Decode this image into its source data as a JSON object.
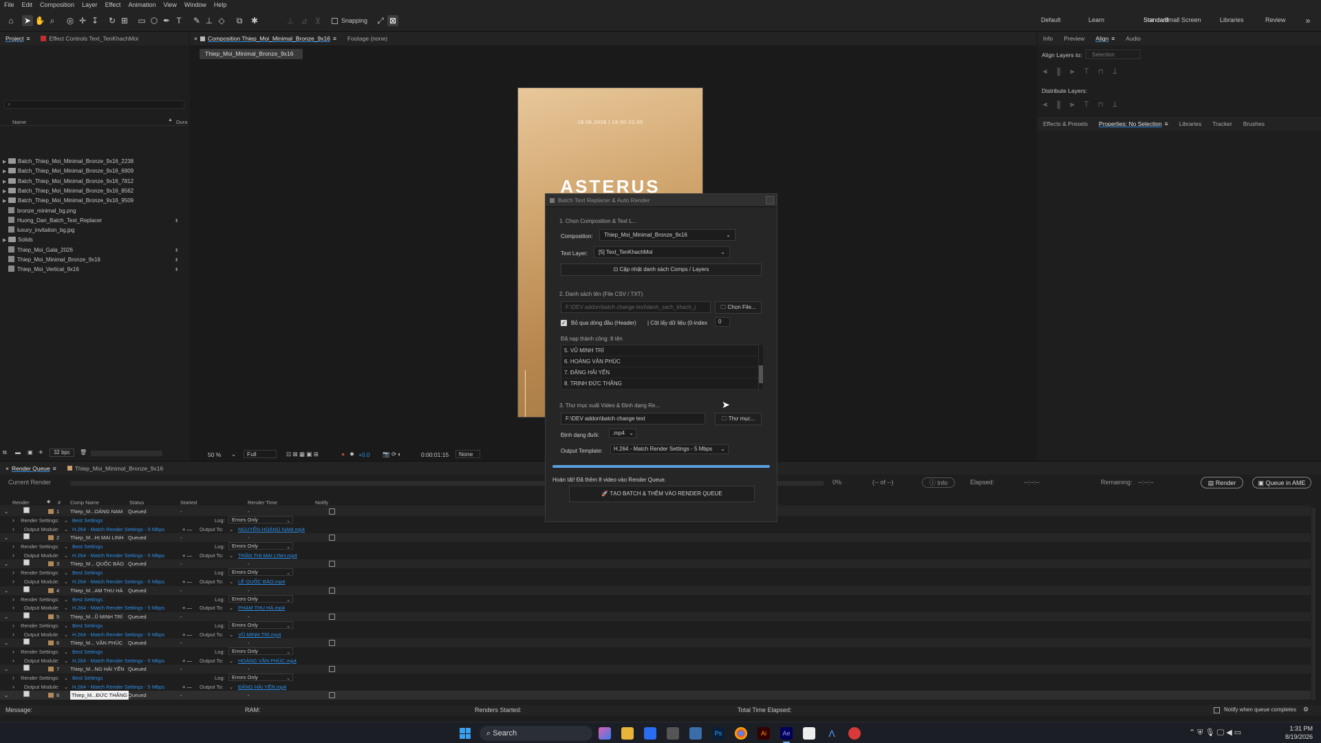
{
  "menu": [
    "File",
    "Edit",
    "Composition",
    "Layer",
    "Effect",
    "Animation",
    "View",
    "Window",
    "Help"
  ],
  "toolbar": {
    "snapping": "Snapping"
  },
  "workspaces": [
    "Default",
    "Learn",
    "Standard",
    "Small Screen",
    "Libraries",
    "Review"
  ],
  "project": {
    "tab": "Project",
    "effect_tab": "Effect Controls Text_TenKhachMoi",
    "col_name": "Name",
    "col_dur": "Dura",
    "items": [
      {
        "name": "Batch_Thiep_Moi_Minimal_Bronze_9x16_2238",
        "type": "folder"
      },
      {
        "name": "Batch_Thiep_Moi_Minimal_Bronze_9x16_6909",
        "type": "folder"
      },
      {
        "name": "Batch_Thiep_Moi_Minimal_Bronze_9x16_7812",
        "type": "folder"
      },
      {
        "name": "Batch_Thiep_Moi_Minimal_Bronze_9x16_8562",
        "type": "folder"
      },
      {
        "name": "Batch_Thiep_Moi_Minimal_Bronze_9x16_9509",
        "type": "folder"
      },
      {
        "name": "bronze_minimal_bg.png",
        "type": "file"
      },
      {
        "name": "Huong_Dan_Batch_Text_Replacer",
        "type": "file"
      },
      {
        "name": "luxury_invitation_bg.jpg",
        "type": "file"
      },
      {
        "name": "Solids",
        "type": "folder"
      },
      {
        "name": "Thiep_Moi_Gala_2026",
        "type": "comp"
      },
      {
        "name": "Thiep_Moi_Minimal_Bronze_9x16",
        "type": "comp"
      },
      {
        "name": "Thiep_Moi_Vertical_9x16",
        "type": "comp"
      }
    ],
    "bpc": "32 bpc"
  },
  "comp": {
    "tab": "Composition Thiep_Moi_Minimal_Bronze_9x16",
    "footage": "Footage (none)",
    "chip": "Thiep_Moi_Minimal_Bronze_9x16",
    "date": "18.06.2026   |   18:00-22:00",
    "title": "ASTERUS",
    "zoom": "50 %",
    "res": "Full",
    "exposure": "+0.0",
    "time": "0:00:01:15",
    "view": "None"
  },
  "right": {
    "tabs": [
      "Info",
      "Preview",
      "Align",
      "Audio"
    ],
    "align_to_label": "Align Layers to:",
    "align_to_value": "Selection",
    "distribute": "Distribute Layers:",
    "tabs2": [
      "Effects & Presets",
      "Properties: No Selection",
      "Libraries",
      "Tracker",
      "Brushes"
    ]
  },
  "dialog": {
    "title": "Batch Text Replacer & Auto Render",
    "s1": "1. Chọn Composition & Text L...",
    "comp_label": "Composition:",
    "comp_value": "Thiep_Moi_Minimal_Bronze_9x16",
    "layer_label": "Text Layer:",
    "layer_value": "[5] Text_TenKhachMoi",
    "refresh": "Cập nhật danh sách Comps / Layers",
    "s2": "2. Danh sách tên (File CSV / TXT)",
    "file_path": "F:\\DEV addon\\batch change text\\danh_sach_khach_j",
    "choose_file": "Chọn File...",
    "skip_header": "Bỏ qua dòng đầu (Header)",
    "col_label": "| Cột lấy dữ liệu (0-index",
    "col_value": "0",
    "loaded": "Đã nạp thành công: 8 tên",
    "names": [
      "5. VŨ MINH TRÍ",
      "6. HOÀNG VĂN PHÚC",
      "7. ĐẶNG HẢI YẾN",
      "8. TRỊNH ĐỨC THẮNG"
    ],
    "s3": "3. Thư mục xuất Video & Định dạng Re...",
    "out_path": "F:\\DEV addon\\batch change text",
    "folder_btn": "Thư mục...",
    "format_label": "Định dạng đuôi:",
    "format_value": ".mp4",
    "template_label": "Output Template:",
    "template_value": "H.264 - Match Render Settings - 5 Mbps",
    "progress": 1.0,
    "done": "Hoàn tất! Đã thêm 8 video vào Render Queue.",
    "run_btn": "TẠO BATCH & THÊM VÀO RENDER QUEUE"
  },
  "rq": {
    "tab": "Render Queue",
    "comp_tab": "Thiep_Moi_Minimal_Bronze_9x16",
    "current": "Current Render",
    "pct": "0%",
    "of": "(-- of --)",
    "info": "Info",
    "elapsed": "Elapsed:",
    "elapsed_v": "--:--:--",
    "remaining": "Remaining:",
    "remaining_v": "--:--:--",
    "render": "Render",
    "ame": "Queue in AME",
    "cols": [
      "Render",
      "#",
      "Comp Name",
      "Status",
      "Started",
      "Render Time",
      "Notify"
    ],
    "rs_label": "Render Settings:",
    "rs_value": "Best Settings",
    "om_label": "Output Module:",
    "om_value": "H.264 - Match Render Settings - 5 Mbps",
    "log_label": "Log:",
    "log_value": "Errors Only",
    "out_label": "Output To:",
    "items": [
      {
        "n": "1",
        "name": "Thiep_M...OÀNG NAM",
        "status": "Queued",
        "out": "NGUYỄN HOÀNG NAM.mp4"
      },
      {
        "n": "2",
        "name": "Thiep_M...HỊ MAI LINH",
        "status": "Queued",
        "out": "TRẦN THỊ MAI LINH.mp4"
      },
      {
        "n": "3",
        "name": "Thiep_M... QUỐC BẢO",
        "status": "Queued",
        "out": "LÊ QUỐC BẢO.mp4"
      },
      {
        "n": "4",
        "name": "Thiep_M...AM THU HÀ",
        "status": "Queued",
        "out": "PHẠM THU HÀ.mp4"
      },
      {
        "n": "5",
        "name": "Thiep_M...Ũ MINH TRÍ",
        "status": "Queued",
        "out": "VŨ MINH TRÍ.mp4"
      },
      {
        "n": "6",
        "name": "Thiep_M... VĂN PHÚC",
        "status": "Queued",
        "out": "HOÀNG VĂN PHÚC.mp4"
      },
      {
        "n": "7",
        "name": "Thiep_M...NG HẢI YẾN",
        "status": "Queued",
        "out": "ĐẶNG HẢI YẾN.mp4"
      },
      {
        "n": "8",
        "name": "Thiep_M...ĐỨC THẮNG",
        "status": "Queued",
        "out": ""
      }
    ]
  },
  "status": {
    "message": "Message:",
    "ram": "RAM:",
    "started": "Renders Started:",
    "total": "Total Time Elapsed:",
    "notify": "Notify when queue completes"
  },
  "taskbar": {
    "search": "Search",
    "time": "1:31 PM",
    "date": "8/19/2026"
  }
}
